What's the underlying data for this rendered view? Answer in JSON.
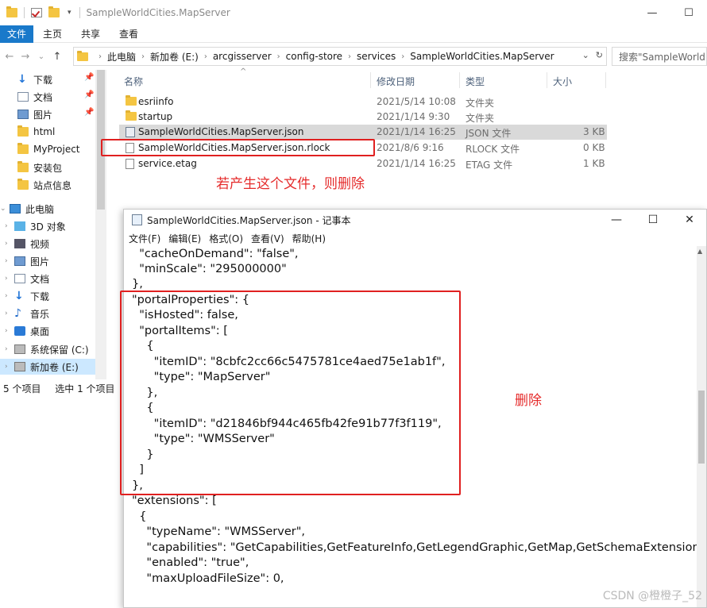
{
  "explorer": {
    "title": "SampleWorldCities.MapServer",
    "window_controls": {
      "minimize": "—",
      "maximize": "☐"
    },
    "ribbon_tabs": [
      "文件",
      "主页",
      "共享",
      "查看"
    ],
    "nav_arrows": {
      "back": "←",
      "forward": "→",
      "recent": "⌄",
      "up": "↑"
    },
    "breadcrumb": [
      "此电脑",
      "新加卷 (E:)",
      "arcgisserver",
      "config-store",
      "services",
      "SampleWorldCities.MapServer"
    ],
    "address_controls": {
      "dropdown": "⌄",
      "refresh": "↻"
    },
    "search_placeholder": "搜索\"SampleWorld...",
    "nav_pane": {
      "quick_access": [
        {
          "label": "下载",
          "pinned": true
        },
        {
          "label": "文档",
          "pinned": true
        },
        {
          "label": "图片",
          "pinned": true
        },
        {
          "label": "html"
        },
        {
          "label": "MyProject"
        },
        {
          "label": "安装包"
        },
        {
          "label": "站点信息"
        }
      ],
      "this_pc": "此电脑",
      "pc_items": [
        "3D 对象",
        "视频",
        "图片",
        "文档",
        "下载",
        "音乐",
        "桌面",
        "系统保留 (C:)",
        "新加卷 (E:)"
      ]
    },
    "columns": {
      "name": "名称",
      "date": "修改日期",
      "type": "类型",
      "size": "大小"
    },
    "files": [
      {
        "name": "esriinfo",
        "date": "2021/5/14 10:08",
        "type": "文件夹",
        "size": ""
      },
      {
        "name": "startup",
        "date": "2021/1/14 9:30",
        "type": "文件夹",
        "size": ""
      },
      {
        "name": "SampleWorldCities.MapServer.json",
        "date": "2021/1/14 16:25",
        "type": "JSON 文件",
        "size": "3 KB"
      },
      {
        "name": "SampleWorldCities.MapServer.json.rlock",
        "date": "2021/8/6 9:16",
        "type": "RLOCK 文件",
        "size": "0 KB"
      },
      {
        "name": "service.etag",
        "date": "2021/1/14 16:25",
        "type": "ETAG 文件",
        "size": "1 KB"
      }
    ],
    "status": {
      "count": "5 个项目",
      "selected": "选中 1 个项目",
      "cut": "2"
    }
  },
  "annotations": {
    "delete_if_exists": "若产生这个文件，则删除",
    "delete": "删除"
  },
  "notepad": {
    "title": "SampleWorldCities.MapServer.json - 记事本",
    "window_controls": {
      "minimize": "—",
      "maximize": "☐",
      "close": "✕"
    },
    "menu": [
      "文件(F)",
      "编辑(E)",
      "格式(O)",
      "查看(V)",
      "帮助(H)"
    ],
    "lines": [
      "  \"cacheOnDemand\": \"false\",",
      "  \"minScale\": \"295000000\"",
      "},",
      "\"portalProperties\": {",
      "  \"isHosted\": false,",
      "  \"portalItems\": [",
      "    {",
      "      \"itemID\": \"8cbfc2cc66c5475781ce4aed75e1ab1f\",",
      "      \"type\": \"MapServer\"",
      "    },",
      "    {",
      "      \"itemID\": \"d21846bf944c465fb42fe91b77f3f119\",",
      "      \"type\": \"WMSServer\"",
      "    }",
      "  ]",
      "},",
      "\"extensions\": [",
      "  {",
      "    \"typeName\": \"WMSServer\",",
      "    \"capabilities\": \"GetCapabilities,GetFeatureInfo,GetLegendGraphic,GetMap,GetSchemaExtension,G",
      "    \"enabled\": \"true\",",
      "    \"maxUploadFileSize\": 0,"
    ]
  },
  "watermark": "CSDN @橙橙子_52"
}
